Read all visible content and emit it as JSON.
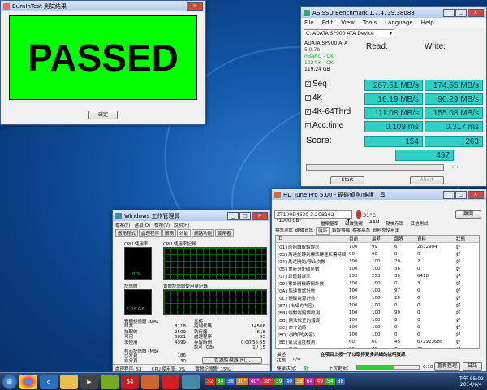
{
  "burnin": {
    "title": "BurnInTest 測試結果",
    "result": "PASSED",
    "ok_button": "確定"
  },
  "asssd": {
    "title": "AS SSD Benchmark 1.7.4739.38088",
    "menu": [
      "File",
      "Edit",
      "View",
      "Tools",
      "Language",
      "Help"
    ],
    "drive_select": "C: ADATA SP900 ATA Device",
    "drive_info": [
      "ADATA SP900 ATA",
      "5.0.7b",
      "msahci - OK",
      "1024 K - OK",
      "119.24 GB"
    ],
    "read_header": "Read:",
    "write_header": "Write:",
    "rows": [
      {
        "label": "Seq",
        "read": "267.51 MB/s",
        "write": "174.55 MB/s"
      },
      {
        "label": "4K",
        "read": "16.19 MB/s",
        "write": "90.29 MB/s"
      },
      {
        "label": "4K-64Thrd",
        "read": "111.08 MB/s",
        "write": "155.08 MB/s"
      },
      {
        "label": "Acc.time",
        "read": "0.109 ms",
        "write": "0.317 ms"
      }
    ],
    "score_label": "Score:",
    "score_read": "154",
    "score_write": "263",
    "score_total": "497",
    "start_button": "Start",
    "abort_button": "Abort",
    "progress_label": "---:--:--"
  },
  "taskmgr": {
    "title": "Windows 工作管理員",
    "menu": [
      "檔案(F)",
      "選項(O)",
      "檢視(V)",
      "說明(H)"
    ],
    "tabs": [
      "應用程式",
      "處理程序",
      "服務",
      "效能",
      "網路功能",
      "使用者"
    ],
    "cpu_usage_label": "CPU 使用率",
    "cpu_usage_value": "0 %",
    "cpu_history_label": "CPU 使用率記錄",
    "mem_label": "記憶體",
    "mem_value": "1.28 GB",
    "mem_history_label": "實體記憶體使用量記錄",
    "phys_mem_header": "實體記憶體 (MB)",
    "phys_mem": [
      {
        "k": "總共",
        "v": "8118"
      },
      {
        "k": "快取的",
        "v": "2509"
      },
      {
        "k": "可用",
        "v": "6821"
      },
      {
        "k": "未使用",
        "v": "4399"
      }
    ],
    "kernel_header": "核心記憶體 (MB)",
    "kernel": [
      {
        "k": "已分頁",
        "v": "186"
      },
      {
        "k": "非分頁",
        "v": "30"
      }
    ],
    "system_header": "系統",
    "system": [
      {
        "k": "控制代碼",
        "v": "14506"
      },
      {
        "k": "執行緒",
        "v": "618"
      },
      {
        "k": "處理程序",
        "v": "53"
      },
      {
        "k": "存留時間",
        "v": "0:00:55:55"
      },
      {
        "k": "認可 (GB)",
        "v": "1 / 15"
      }
    ],
    "monitor_button": "資源監視器(R)...",
    "status_processes": "處理程序: 53",
    "status_cpu": "CPU 使用率: 0%",
    "status_mem": "實體記憶體: 15%"
  },
  "hdtune": {
    "title": "HD Tune Pro 5.00 - 硬碟偵測/維護工具",
    "drive_select": "ZT100D4630-3.2CB162 (1000 gB)",
    "temp": "31°C",
    "exit_button": "離開",
    "toolbar_tabs": [
      "檔案基準",
      "磁碟監視",
      "AAM",
      "隨機存取",
      "其他測試"
    ],
    "tabs": [
      "標準測試",
      "硬碟資訊",
      "健康",
      "錯誤掃描",
      "檔案基準",
      "資料夾使用率"
    ],
    "columns": [
      "ID",
      "目前",
      "最差",
      "臨界",
      "資料",
      "狀態"
    ],
    "rows": [
      {
        "id": "(01) 原始讀取錯誤率",
        "cur": "100",
        "worst": "99",
        "thr": "6",
        "data": "2832904",
        "st": "好"
      },
      {
        "id": "(03) 馬達旋轉到標準轉速所需時間",
        "cur": "99",
        "worst": "99",
        "thr": "0",
        "data": "0",
        "st": "好"
      },
      {
        "id": "(04) 馬達開始/停止次數",
        "cur": "100",
        "worst": "100",
        "thr": "20",
        "data": "2",
        "st": "好"
      },
      {
        "id": "(05) 重新分配磁區數",
        "cur": "100",
        "worst": "100",
        "thr": "36",
        "data": "0",
        "st": "好"
      },
      {
        "id": "(07) 尋道錯誤率",
        "cur": "253",
        "worst": "253",
        "thr": "30",
        "data": "6418",
        "st": "好"
      },
      {
        "id": "(09) 累計開機時間計數",
        "cur": "100",
        "worst": "100",
        "thr": "0",
        "data": "3",
        "st": "好"
      },
      {
        "id": "(0A) 馬達重試計數",
        "cur": "100",
        "worst": "100",
        "thr": "97",
        "data": "0",
        "st": "好"
      },
      {
        "id": "(0C) 硬碟電源計數",
        "cur": "100",
        "worst": "100",
        "thr": "20",
        "data": "0",
        "st": "好"
      },
      {
        "id": "(B7) (未知的內容)",
        "cur": "100",
        "worst": "100",
        "thr": "0",
        "data": "0",
        "st": "好"
      },
      {
        "id": "(B8) 端對端錯誤檢測",
        "cur": "100",
        "worst": "100",
        "thr": "99",
        "data": "0",
        "st": "好"
      },
      {
        "id": "(BB) 無法修正的錯誤",
        "cur": "100",
        "worst": "100",
        "thr": "0",
        "data": "0",
        "st": "好"
      },
      {
        "id": "(BC) 命令逾時",
        "cur": "100",
        "worst": "100",
        "thr": "0",
        "data": "0",
        "st": "好"
      },
      {
        "id": "(BD) (未知的內容)",
        "cur": "100",
        "worst": "100",
        "thr": "0",
        "data": "0",
        "st": "好"
      },
      {
        "id": "(BE) 氣流溫度檢測",
        "cur": "60",
        "worst": "60",
        "thr": "45",
        "data": "672923688",
        "st": "好"
      },
      {
        "id": "(C2) 溫度",
        "cur": "31",
        "worst": "40",
        "thr": "0",
        "data": "31",
        "st": "好"
      }
    ],
    "detail_label": "描述：",
    "detail_text": "在項目上按一下以取得更多詳細的說明資訊",
    "status_label": "狀態：",
    "status_value": "n/a",
    "health_label": "健康狀況：",
    "health_value": "好",
    "next_update_label": "下次更新：",
    "next_update_value": "0:10",
    "refresh_button": "重新整理",
    "log_button": "日誌"
  },
  "taskbar": {
    "tray_numbers": [
      "32",
      "34",
      "38",
      "30°",
      "40°",
      "38°",
      "39",
      "40",
      "38",
      "64",
      "49",
      "54",
      "38"
    ],
    "time": "下午 05:02",
    "date": "2014/6/4"
  }
}
